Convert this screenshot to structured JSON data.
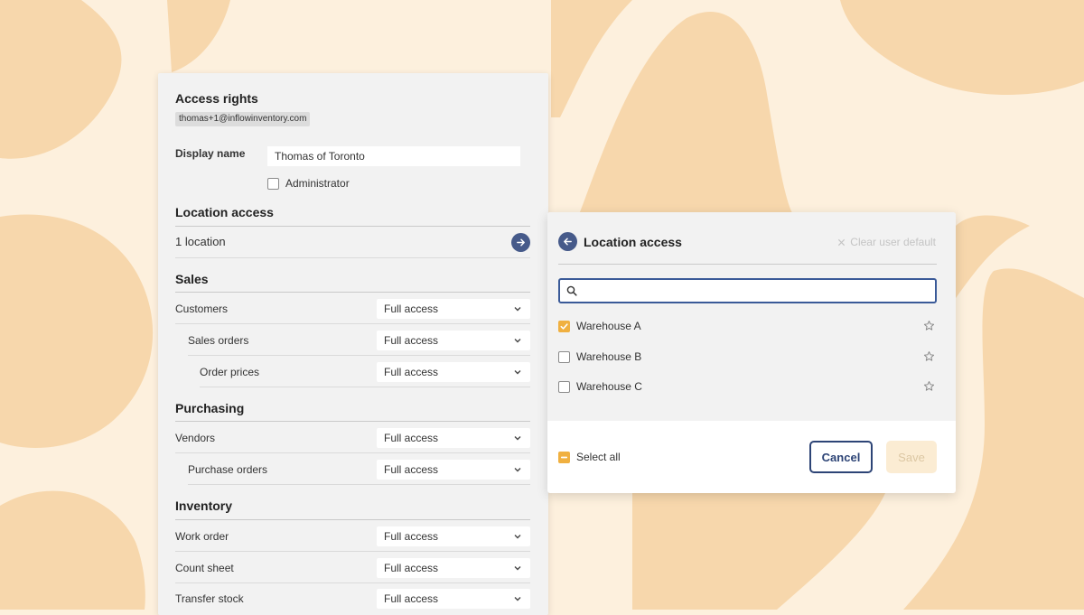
{
  "colors": {
    "background": "#fdf0dd",
    "blob": "#f7d7ac",
    "accent_navy": "#465a8a",
    "checkbox_orange": "#f0b040"
  },
  "access_rights": {
    "title": "Access rights",
    "email": "thomas+1@inflowinventory.com",
    "display_name_label": "Display name",
    "display_name_value": "Thomas of Toronto",
    "administrator_label": "Administrator",
    "administrator_checked": false,
    "location_access": {
      "heading": "Location access",
      "summary": "1 location",
      "icon": "arrow-right-icon"
    },
    "sections": [
      {
        "heading": "Sales",
        "rows": [
          {
            "label": "Customers",
            "value": "Full access"
          },
          {
            "label": "Sales orders",
            "value": "Full access"
          },
          {
            "label": "Order prices",
            "value": "Full access"
          }
        ]
      },
      {
        "heading": "Purchasing",
        "rows": [
          {
            "label": "Vendors",
            "value": "Full access"
          },
          {
            "label": "Purchase orders",
            "value": "Full access"
          }
        ]
      },
      {
        "heading": "Inventory",
        "rows": [
          {
            "label": "Work order",
            "value": "Full access"
          },
          {
            "label": "Count sheet",
            "value": "Full access"
          },
          {
            "label": "Transfer stock",
            "value": "Full access"
          }
        ]
      }
    ]
  },
  "location_dialog": {
    "title": "Location access",
    "back_icon": "arrow-left-icon",
    "clear_label": "Clear user default",
    "search_value": "",
    "search_placeholder": "",
    "warehouses": [
      {
        "label": "Warehouse A",
        "checked": true
      },
      {
        "label": "Warehouse B",
        "checked": false
      },
      {
        "label": "Warehouse C",
        "checked": false
      }
    ],
    "select_all_label": "Select all",
    "select_all_state": "indeterminate",
    "cancel_label": "Cancel",
    "save_label": "Save"
  }
}
